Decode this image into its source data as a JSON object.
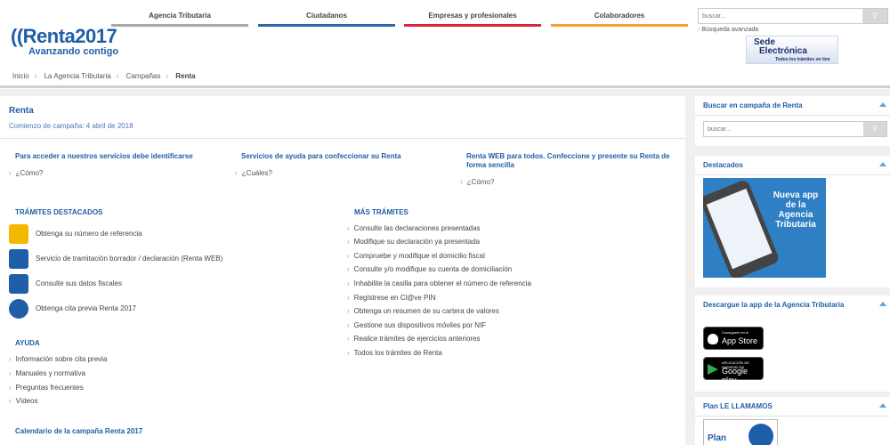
{
  "nav": {
    "tabs": [
      {
        "label": "Agencia Tributaria",
        "color": "#aaaaaa"
      },
      {
        "label": "Ciudadanos",
        "color": "#2f67ad"
      },
      {
        "label": "Empresas y profesionales",
        "color": "#d9283a"
      },
      {
        "label": "Colaboradores",
        "color": "#f1a33a"
      }
    ],
    "search_placeholder": "buscar...",
    "advanced_search": "Búsqueda avanzada"
  },
  "logo": {
    "brand": "Renta",
    "year": "2017",
    "tagline": "Avanzando contigo"
  },
  "sede": {
    "line1": "Sede",
    "line2": "Electrónica",
    "line3": "Todos los trámites on line"
  },
  "breadcrumb": {
    "items": [
      "Inicio",
      "La Agencia Tributaria",
      "Campañas"
    ],
    "current": "Renta"
  },
  "main": {
    "title": "Renta",
    "subtitle": "Comienzo de campaña: 4 abril de 2018",
    "columns": [
      {
        "title": "Para acceder a nuestros servicios debe identificarse",
        "link": "¿Cómo?"
      },
      {
        "title": "Servicios de ayuda para confeccionar su Renta",
        "link": "¿Cuáles?"
      },
      {
        "title": "Renta WEB para todos. Confeccione y presente su Renta de forma sencilla",
        "link": "¿Cómo?"
      }
    ],
    "tramites_title": "Trámites destacados",
    "tramites": [
      {
        "label": "Obtenga su número de referencia",
        "icon": "reference-number-icon",
        "color": "#f5b800"
      },
      {
        "label": "Servicio de tramitación borrador / declaración (Renta WEB)",
        "icon": "renta-web-icon",
        "color": "#1f5ea8"
      },
      {
        "label": "Consulte sus datos fiscales",
        "icon": "fiscal-data-icon",
        "color": "#1f5ea8"
      },
      {
        "label": "Obtenga cita previa Renta 2017",
        "icon": "appointment-clock-icon",
        "color": "#1f5ea8"
      }
    ],
    "mas_title": "Más trámites",
    "mas": [
      "Consulte las declaraciones presentadas",
      "Modifique su declaración ya presentada",
      "Compruebe y modifique el domicilio fiscal",
      "Consulte y/o modifique su cuenta de domiciliación",
      "Inhabilite la casilla para obtener el número de referencia",
      "Regístrese en Cl@ve PIN",
      "Obtenga un resumen de su cartera de valores",
      "Gestione sus dispositivos móviles por NIF",
      "Realice trámites de ejercicios anteriores",
      "Todos los trámites de Renta"
    ],
    "ayuda_title": "Ayuda",
    "ayuda": [
      "Información sobre cita previa",
      "Manuales y normativa",
      "Preguntas frecuentes",
      "Vídeos"
    ],
    "calendario": "Calendario de la campaña Renta 2017"
  },
  "sidebar": {
    "search_title": "Buscar en campaña de Renta",
    "search_placeholder": "buscar...",
    "destacados_title": "Destacados",
    "promo_text": "Nueva app de la Agencia Tributaria",
    "descargue_title": "Descargue la app de la Agencia Tributaria",
    "appstore_small": "Consíguelo en el",
    "appstore_big": "App Store",
    "gplay_small": "APLICACIÓN DE ANDROID EN",
    "gplay_big": "Google play",
    "plan_title": "Plan LE LLAMAMOS",
    "plan_text": "Plan"
  }
}
